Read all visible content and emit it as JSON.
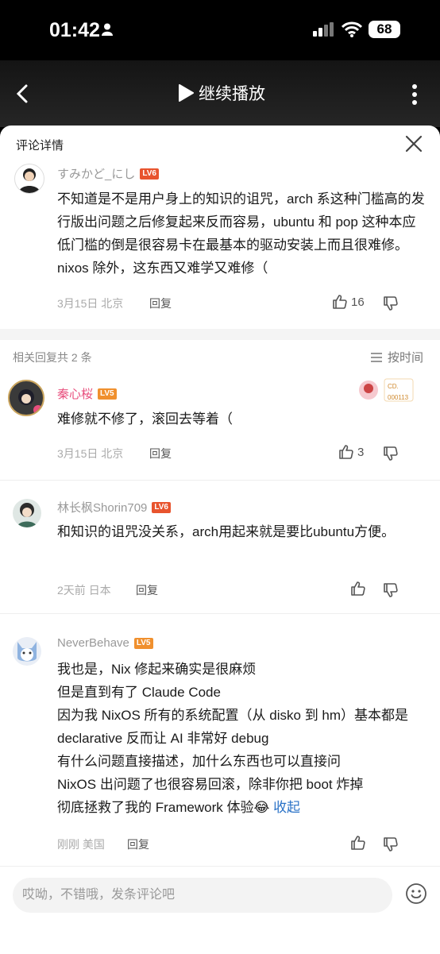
{
  "status": {
    "time": "01:42",
    "battery": "68"
  },
  "nav": {
    "play_label": "继续播放"
  },
  "sheet": {
    "title": "评论详情"
  },
  "main_comment": {
    "user": "すみかど_にし",
    "level": "LV6",
    "text": "不知道是不是用户身上的知识的诅咒，arch 系这种门槛高的发行版出问题之后修复起来反而容易，ubuntu 和 pop 这种本应低门槛的倒是很容易卡在最基本的驱动安装上而且很难修。nixos 除外，这东西又难学又难修（",
    "date": "3月15日",
    "location": "北京",
    "reply_label": "回复",
    "likes": "16"
  },
  "related": {
    "label": "相关回复共 2 条",
    "sort_label": "按时间"
  },
  "replies": [
    {
      "user": "秦心桜",
      "level": "LV5",
      "text": "难修就不修了，滚回去等着（",
      "date": "3月15日",
      "location": "北京",
      "reply_label": "回复",
      "likes": "3",
      "badge_text": "CD.",
      "badge_num": "000113"
    },
    {
      "user": "林长枫Shorin709",
      "level": "LV6",
      "text": "和知识的诅咒没关系，arch用起来就是要比ubuntu方便。",
      "date": "2天前",
      "location": "日本",
      "reply_label": "回复"
    },
    {
      "user": "NeverBehave",
      "level": "LV5",
      "lines": [
        "我也是，Nix 修起来确实是很麻烦",
        "但是直到有了 Claude Code",
        "因为我 NixOS 所有的系统配置（从 disko 到 hm）基本都是 declarative 反而让 AI 非常好 debug",
        "有什么问题直接描述，加什么东西也可以直接问",
        "NixOS 出问题了也很容易回滚，除非你把 boot 炸掉",
        "彻底拯救了我的 Framework 体验😂"
      ],
      "fold_label": "收起",
      "date": "刚刚",
      "location": "美国",
      "reply_label": "回复"
    }
  ],
  "input": {
    "placeholder": "哎呦，不错哦，发条评论吧"
  },
  "colors": {
    "lv6": "#e8542e",
    "lv5": "#f0902e",
    "vip_name": "#e84f7d",
    "link": "#2a72c7"
  }
}
